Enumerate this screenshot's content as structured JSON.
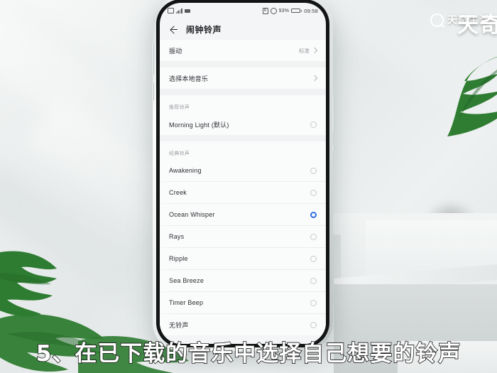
{
  "watermark": {
    "text": "天奇生活",
    "big_text": "天奇",
    "logo": "magnifier-logo"
  },
  "subtitle": "5、在已下载的音乐中选择自己想要的铃声",
  "phone": {
    "status_bar": {
      "battery_percent": "93%",
      "time": "09:58",
      "left_icons": [
        "sim-icon",
        "signal-bars-icon",
        "camera-icon"
      ],
      "right_icons": [
        "nfc-icon",
        "alarm-icon",
        "battery-icon"
      ]
    },
    "app_bar": {
      "back": "back-arrow",
      "title": "闹钟铃声"
    },
    "rows": [
      {
        "label": "振动",
        "value": "标准",
        "type": "chevron"
      },
      {
        "label": "选择本地音乐",
        "value": "",
        "type": "chevron"
      }
    ],
    "sections": [
      {
        "header": "推荐铃声",
        "items": [
          {
            "label": "Morning Light (默认)",
            "selected": false
          }
        ]
      },
      {
        "header": "经典铃声",
        "items": [
          {
            "label": "Awakening",
            "selected": false
          },
          {
            "label": "Creek",
            "selected": false
          },
          {
            "label": "Ocean Whisper",
            "selected": true
          },
          {
            "label": "Rays",
            "selected": false
          },
          {
            "label": "Ripple",
            "selected": false
          },
          {
            "label": "Sea Breeze",
            "selected": false
          },
          {
            "label": "Timer Beep",
            "selected": false
          },
          {
            "label": "无铃声",
            "selected": false
          }
        ]
      }
    ],
    "accent_color": "#2f6fe4"
  }
}
